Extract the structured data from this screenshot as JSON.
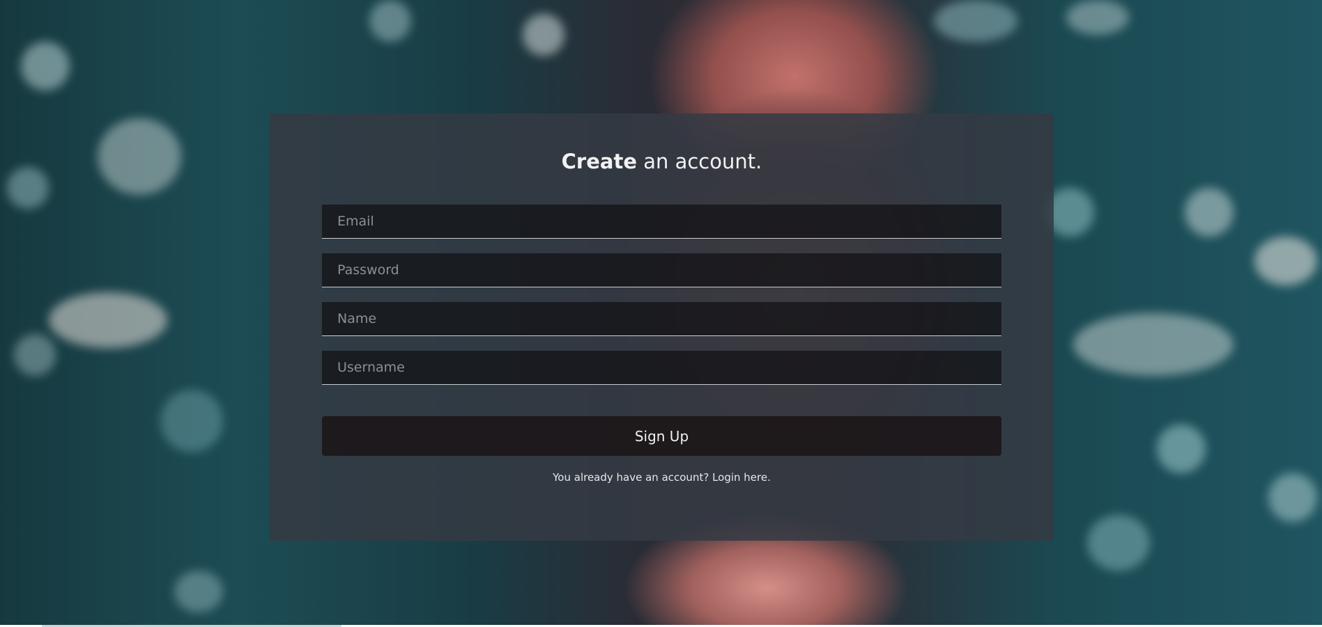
{
  "form": {
    "title_bold": "Create",
    "title_rest": " an account.",
    "fields": [
      {
        "placeholder": "Email",
        "value": ""
      },
      {
        "placeholder": "Password",
        "value": ""
      },
      {
        "placeholder": "Name",
        "value": ""
      },
      {
        "placeholder": "Username",
        "value": ""
      }
    ],
    "submit_label": "Sign Up",
    "footer_text": "You already have an account? ",
    "footer_link": "Login here."
  },
  "colors": {
    "card_bg": "#343a44",
    "field_bg": "#0c0a0c",
    "button_bg": "#1a1214",
    "text": "#f2f2f2"
  }
}
